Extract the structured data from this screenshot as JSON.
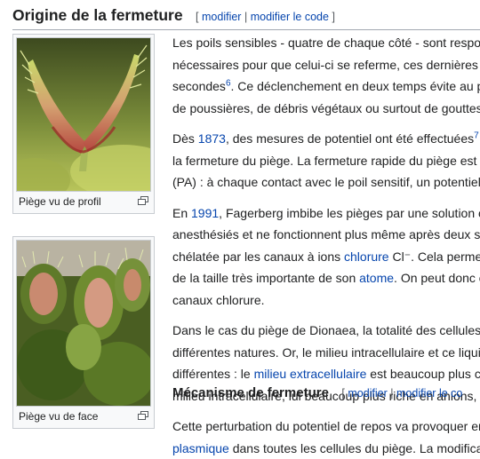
{
  "section": {
    "title": "Origine de la fermeture",
    "bracket_open": "[",
    "edit_label": "modifier",
    "separator": "|",
    "edit_code_label": "modifier le code",
    "bracket_close": "]"
  },
  "figures": [
    {
      "caption": "Piège vu de profil"
    },
    {
      "caption": "Piège vu de face"
    }
  ],
  "paragraphs": {
    "p1": {
      "line1": "Les poils sensibles - quatre de chaque côté - sont respo",
      "line2": "nécessaires pour que celui-ci se referme, ces dernières",
      "line3a": "secondes",
      "line3_ref": "6",
      "line3b": ". Ce déclenchement en deux temps évite au p",
      "line4": "de poussières, de débris végétaux ou surtout de gouttes"
    },
    "p2": {
      "line1a": "Dès ",
      "line1_link": "1873",
      "line1b": ", des mesures de potentiel ont été effectuées",
      "line1_ref": "7",
      "line2": "la fermeture du piège. La fermeture rapide du piège est",
      "line3": "(PA) : à chaque contact avec le poil sensitif, un potentiel"
    },
    "p3": {
      "line1a": "En ",
      "line1_link": "1991",
      "line1b": ", Fagerberg imbibe les pièges par une solution c",
      "line2": "anesthésiés et ne fonctionnent plus même après deux s",
      "line3a": "chélatée par les canaux à ions ",
      "line3_link": "chlorure",
      "line3b": " Cl⁻. Cela permet",
      "line4a": "de la taille très importante de son ",
      "line4_link": "atome",
      "line4b": ". On peut donc c",
      "line5": "canaux chlorure."
    },
    "p4": {
      "line1": "Dans le cas du piège de Dionaea, la totalité des cellules",
      "line2": "différentes natures. Or, le milieu intracellulaire et ce liqui",
      "line3a": "différentes : le ",
      "line3_link": "milieu extracellulaire",
      "line3b": " est beaucoup plus c",
      "line4": "milieu intracellulaire, lui beaucoup plus riche en anions,"
    }
  },
  "subsection": {
    "title": "Mécanisme de fermeture",
    "bracket_open": "[",
    "edit_label": "modifier",
    "separator": "|",
    "edit_code_label": "modifier le co"
  },
  "p5": {
    "line1": "Cette perturbation du potentiel de repos va provoquer en",
    "line2_link": "plasmique",
    "line2b": " dans toutes les cellules du piège. La modifica"
  },
  "icons": {
    "enlarge": "enlarge-icon"
  },
  "colors": {
    "link": "#0645ad",
    "text": "#202122",
    "border": "#c8ccd1"
  }
}
